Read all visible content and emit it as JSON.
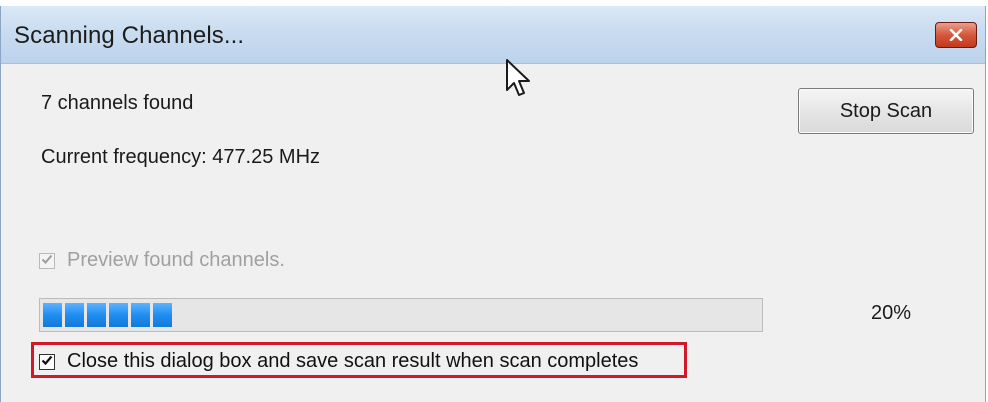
{
  "window": {
    "title": "Scanning Channels..."
  },
  "status": {
    "channels_found": "7 channels found",
    "current_frequency": "Current frequency: 477.25 MHz"
  },
  "buttons": {
    "stop_scan": "Stop Scan"
  },
  "options": {
    "preview_label": "Preview found channels.",
    "preview_checked": true,
    "preview_enabled": false,
    "close_label": "Close this dialog box and save scan result when scan completes",
    "close_checked": true
  },
  "progress": {
    "percent_text": "20%",
    "fraction": 0.2
  },
  "colors": {
    "progress_accent": "#1e8ef2",
    "highlight": "#d01a2a",
    "close_button": "#c9462b"
  },
  "icons": {
    "close": "close-icon",
    "check": "check-icon",
    "cursor": "mouse-pointer-icon"
  }
}
